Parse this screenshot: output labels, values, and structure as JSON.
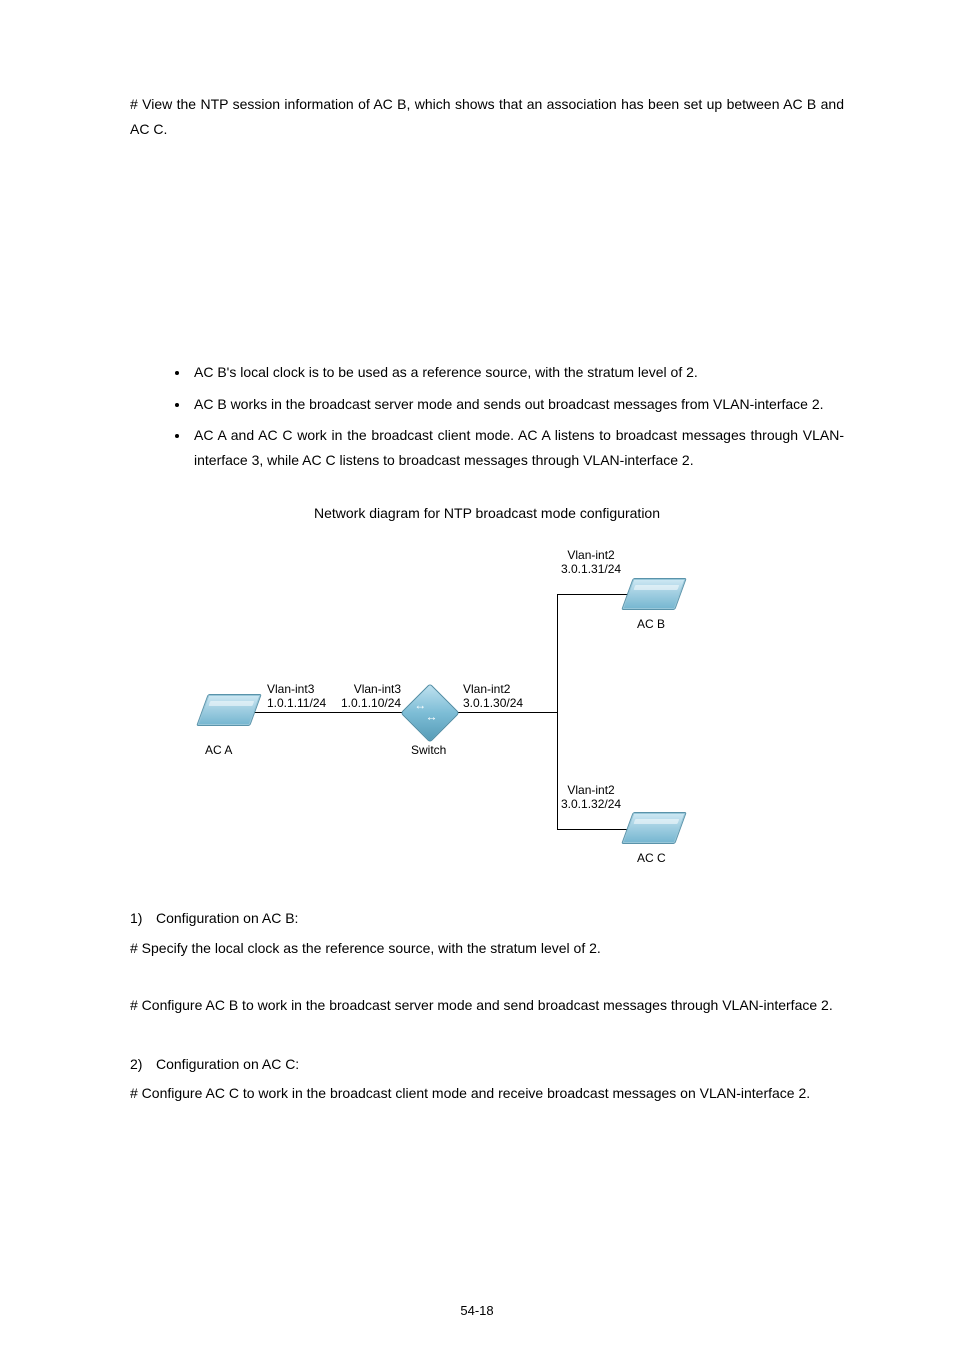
{
  "intro": {
    "text": "# View the NTP session information of AC B, which shows that an association has been set up between AC B and AC C."
  },
  "bullets": [
    "AC B's local clock is to be used as a reference source, with the stratum level of 2.",
    "AC B works in the broadcast server mode and sends out broadcast messages from VLAN-interface 2.",
    "AC A and AC C work in the broadcast client mode. AC A listens to broadcast messages through VLAN-interface 3, while AC C listens to broadcast messages through VLAN-interface 2."
  ],
  "diagram": {
    "caption": "Network diagram for NTP broadcast mode configuration",
    "labels": {
      "acb_if": "Vlan-int2",
      "acb_ip": "3.0.1.31/24",
      "acb": "AC B",
      "aca_if": "Vlan-int3",
      "aca_ip": "1.0.1.11/24",
      "aca": "AC A",
      "sw_left_if": "Vlan-int3",
      "sw_left_ip": "1.0.1.10/24",
      "sw_right_if": "Vlan-int2",
      "sw_right_ip": "3.0.1.30/24",
      "switch": "Switch",
      "acc_if": "Vlan-int2",
      "acc_ip": "3.0.1.32/24",
      "acc": "AC C"
    }
  },
  "config": {
    "step1_num": "1)",
    "step1_title": "Configuration on AC B:",
    "step1_a": "# Specify the local clock as the reference source, with the stratum level of 2.",
    "step1_b": "# Configure AC B to work in the broadcast server mode and send broadcast messages through VLAN-interface 2.",
    "step2_num": "2)",
    "step2_title": "Configuration on AC C:",
    "step2_a": "# Configure AC C to work in the broadcast client mode and receive broadcast messages on VLAN-interface 2."
  },
  "footer": {
    "pagenum": "54-18"
  }
}
